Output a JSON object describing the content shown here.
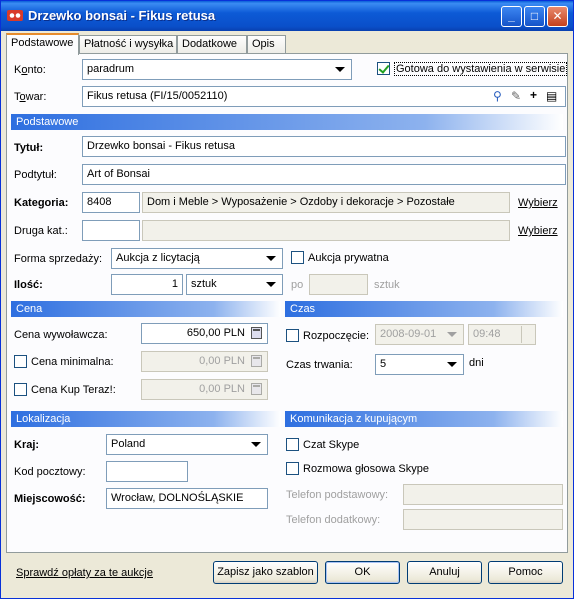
{
  "window": {
    "title": "Drzewko bonsai - Fikus retusa",
    "minimize": "_",
    "maximize": "□",
    "close": "✕"
  },
  "tabs": [
    "Podstawowe",
    "Płatność i wysyłka",
    "Dodatkowe",
    "Opis"
  ],
  "account": {
    "label_ul": "o",
    "label_pre": "K",
    "label_post": "nto:",
    "value": "paradrum",
    "ready_label": "Gotowa do wystawienia w serwisie",
    "ready_checked": true
  },
  "product": {
    "label_pre": "T",
    "label_ul": "o",
    "label_post": "war:",
    "value": "Fikus retusa (FI/15/0052110)",
    "icons": [
      "search-icon",
      "pencil-icon",
      "plus-icon",
      "list-icon"
    ]
  },
  "basic": {
    "header": "Podstawowe",
    "title_label": "Tytuł:",
    "title_value": "Drzewko bonsai - Fikus retusa",
    "subtitle_label": "Podtytuł:",
    "subtitle_value": "Art of Bonsai",
    "category_label": "Kategoria:",
    "category_id": "8408",
    "category_path": "Dom i Meble > Wyposażenie > Ozdoby i dekoracje > Pozostałe",
    "choose_label": "Wybierz",
    "category2_label": "Druga kat.:",
    "category2_id": "",
    "category2_path": "",
    "choose2_label": "Wybierz",
    "sale_form_label": "Forma sprzedaży:",
    "sale_form_value": "Aukcja z licytacją",
    "private_label": "Aukcja prywatna",
    "private_checked": false,
    "quantity_label": "Ilość:",
    "quantity_value": "1",
    "unit_value": "sztuk",
    "per_label": "po",
    "per_value": "",
    "per_unit": "sztuk"
  },
  "price": {
    "header": "Cena",
    "start_label": "Cena wywoławcza:",
    "start_value": "650,00 PLN",
    "min_label": "Cena minimalna:",
    "min_value": "0,00 PLN",
    "min_checked": false,
    "buynow_label": "Cena Kup Teraz!:",
    "buynow_value": "0,00 PLN",
    "buynow_checked": false
  },
  "time": {
    "header": "Czas",
    "start_label": "Rozpoczęcie:",
    "start_checked": false,
    "date_value": "2008-09-01",
    "time_value": "09:48",
    "duration_label": "Czas trwania:",
    "duration_value": "5",
    "days_label": "dni"
  },
  "location": {
    "header": "Lokalizacja",
    "country_label": "Kraj:",
    "country_value": "Poland",
    "postal_label": "Kod pocztowy:",
    "postal_value": "",
    "city_label": "Miejscowość:",
    "city_value": "Wrocław, DOLNOŚLĄSKIE"
  },
  "contact": {
    "header": "Komunikacja z kupującym",
    "chat_label": "Czat Skype",
    "chat_checked": false,
    "voice_label": "Rozmowa głosowa Skype",
    "voice_checked": false,
    "phone1_label": "Telefon podstawowy:",
    "phone1_value": "",
    "phone2_label": "Telefon dodatkowy:",
    "phone2_value": ""
  },
  "footer": {
    "fees_link": "Sprawdź opłaty za te aukcje",
    "template_button": "Zapisz jako szablon",
    "ok_button": "OK",
    "cancel_button": "Anuluj",
    "help_button": "Pomoc"
  }
}
